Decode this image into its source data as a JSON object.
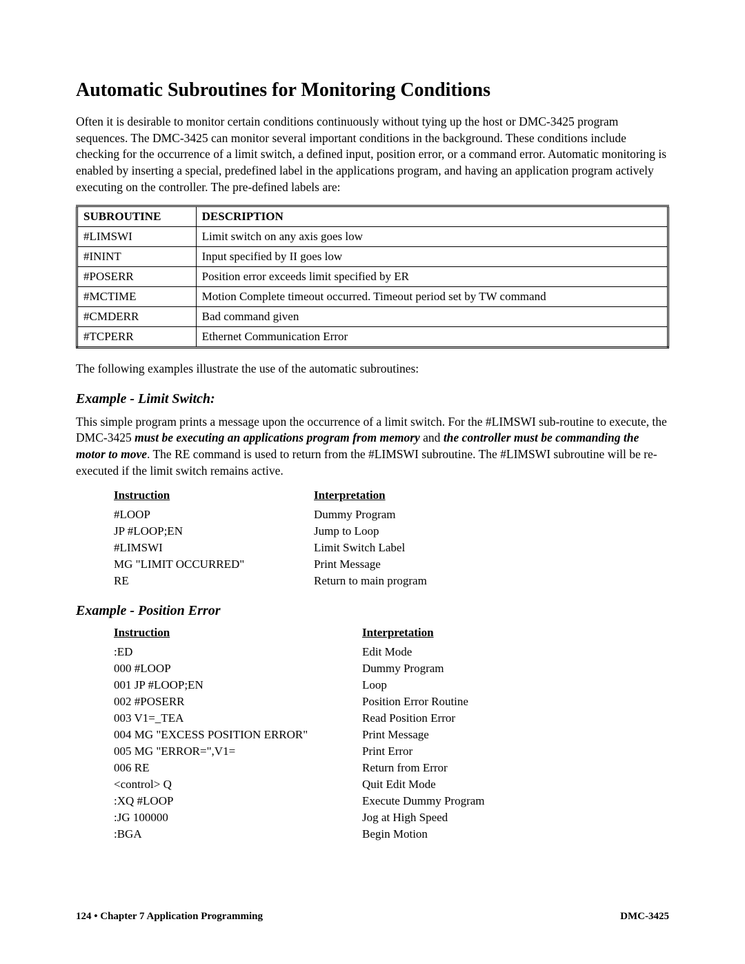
{
  "heading": "Automatic Subroutines for Monitoring Conditions",
  "intro": "Often it is desirable to monitor certain conditions continuously without tying up the host or DMC-3425 program sequences.  The DMC-3425 can monitor several important conditions in the background.  These conditions include checking for the occurrence of a limit switch, a defined input, position error, or a command error.  Automatic monitoring is enabled by inserting a special, predefined label in the applications program, and having an application program actively executing on the controller.  The pre-defined labels are:",
  "table": {
    "h_sub": "SUBROUTINE",
    "h_desc": "DESCRIPTION",
    "rows": [
      {
        "sub": "#LIMSWI",
        "desc": "Limit switch on any axis goes low"
      },
      {
        "sub": "#ININT",
        "desc": "Input specified by II goes low"
      },
      {
        "sub": "#POSERR",
        "desc": "Position error exceeds limit specified by ER"
      },
      {
        "sub": "#MCTIME",
        "desc": "Motion Complete timeout occurred.  Timeout period set by TW command"
      },
      {
        "sub": "#CMDERR",
        "desc": "Bad command given"
      },
      {
        "sub": "#TCPERR",
        "desc": "Ethernet Communication Error"
      }
    ]
  },
  "after_table": "The following examples illustrate the use of the automatic subroutines:",
  "ex1": {
    "title": "Example - Limit Switch:",
    "p1_a": "This simple program prints a message upon the occurrence of a limit switch.  For the #LIMSWI sub-routine to execute, the DMC-3425 ",
    "p1_b": "must be executing an applications program from memory",
    "p1_c": " and ",
    "p1_d": "the controller must be commanding the motor to move",
    "p1_e": ".  The RE command is used to return from the #LIMSWI subroutine.  The #LIMSWI subroutine will be re-executed if the limit switch remains active.",
    "h_instr": "Instruction",
    "h_interp": "Interpretation",
    "rows": [
      {
        "i": "#LOOP",
        "t": "Dummy Program"
      },
      {
        "i": "JP #LOOP;EN",
        "t": "Jump to Loop"
      },
      {
        "i": "#LIMSWI",
        "t": "Limit Switch Label"
      },
      {
        "i": "MG \"LIMIT OCCURRED\"",
        "t": "Print Message"
      },
      {
        "i": "RE",
        "t": "Return to main program"
      }
    ]
  },
  "ex2": {
    "title": "Example - Position Error",
    "h_instr": "Instruction",
    "h_interp": "Interpretation",
    "rows": [
      {
        "i": ":ED",
        "t": "Edit Mode"
      },
      {
        "i": "000 #LOOP",
        "t": "Dummy Program"
      },
      {
        "i": "001 JP #LOOP;EN",
        "t": "Loop"
      },
      {
        "i": "002 #POSERR",
        "t": "Position Error Routine"
      },
      {
        "i": "003 V1=_TEA",
        "t": "Read Position Error"
      },
      {
        "i": "004 MG \"EXCESS POSITION ERROR\"",
        "t": "Print Message"
      },
      {
        "i": "005 MG \"ERROR=\",V1=",
        "t": "Print Error"
      },
      {
        "i": "006 RE",
        "t": "Return from Error"
      },
      {
        "i": "<control> Q",
        "t": "Quit Edit Mode"
      },
      {
        "i": ":XQ #LOOP",
        "t": "Execute Dummy Program"
      },
      {
        "i": ":JG 100000",
        "t": "Jog at High Speed"
      },
      {
        "i": ":BGA",
        "t": "Begin Motion"
      }
    ]
  },
  "footer": {
    "left": "124 • Chapter 7 Application Programming",
    "right": "DMC-3425"
  }
}
